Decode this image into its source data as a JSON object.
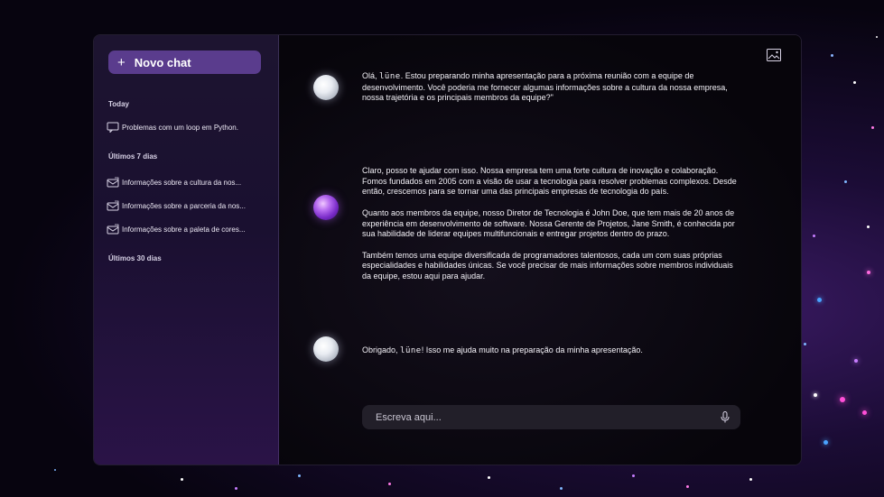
{
  "sidebar": {
    "new_chat_label": "Novo chat",
    "sections": [
      {
        "label": "Today",
        "items": [
          "Problemas com um loop em Python."
        ]
      },
      {
        "label": "Últimos 7 dias",
        "items": [
          "Informações sobre a cultura da nos...",
          "Informações sobre a parceria da nos...",
          "Informações sobre a paleta de cores..."
        ]
      },
      {
        "label": "Últimos 30 dias",
        "items": []
      }
    ]
  },
  "chat": {
    "brand": "lüne",
    "messages": [
      {
        "role": "user",
        "avatar": "moon-avatar",
        "prefix": "Olá, ",
        "brand_suffix": ".",
        "text": " Estou preparando minha apresentação para a próxima reunião com a equipe de desenvolvimento. Você poderia me fornecer algumas informações sobre a cultura da nossa empresa, nossa trajetória e os principais membros da equipe?\""
      },
      {
        "role": "assistant",
        "avatar": "planet-avatar",
        "paragraphs": [
          "Claro, posso te ajudar com isso. Nossa empresa tem uma forte cultura de inovação e colaboração. Fomos fundados em 2005 com a visão de usar a tecnologia para resolver problemas complexos. Desde então, crescemos para se tornar uma das principais empresas de tecnologia do país.",
          "Quanto aos membros da equipe, nosso Diretor de Tecnologia é John Doe, que tem mais de 20 anos de experiência em desenvolvimento de software. Nossa Gerente de Projetos, Jane Smith, é conhecida por sua habilidade de liderar equipes multifuncionais e entregar projetos dentro do prazo.",
          "Também temos uma equipe diversificada de programadores talentosos, cada um com suas próprias especialidades e habilidades únicas. Se você precisar de mais informações sobre membros individuais da equipe, estou aqui para ajudar."
        ]
      },
      {
        "role": "user",
        "avatar": "moon-avatar",
        "prefix": "Obrigado, ",
        "brand_suffix": "!",
        "text": " Isso me ajuda muito na preparação da minha apresentação."
      }
    ]
  },
  "composer": {
    "placeholder": "Escreva aqui...",
    "value": ""
  },
  "icons": {
    "new_chat": "plus-icon",
    "history": "chat-bubble-icon",
    "image": "image-icon",
    "microphone": "microphone-icon"
  },
  "colors": {
    "accent": "#5a3c8d",
    "sidebar_bg": "#1d1430",
    "composer_bg": "#221f29"
  }
}
